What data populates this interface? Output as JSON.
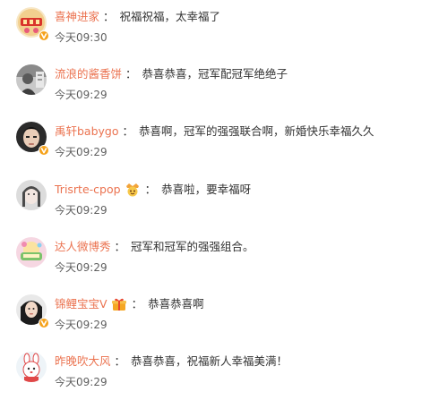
{
  "comments": [
    {
      "user": "喜神进家",
      "separator": "：",
      "text": "祝福祝福，太幸福了",
      "time": "今天09:30",
      "verified": true
    },
    {
      "user": "流浪的酱香饼",
      "separator": "：",
      "text": "恭喜恭喜，冠军配冠军绝绝子",
      "time": "今天09:29",
      "verified": false
    },
    {
      "user": "禹轩babygo",
      "separator": "：",
      "text": "恭喜啊，冠军的强强联合啊，新婚快乐幸福久久",
      "time": "今天09:29",
      "verified": true
    },
    {
      "user": "Trisrte-cpop",
      "separator": "：",
      "text": "恭喜啦，要幸福呀",
      "time": "今天09:29",
      "verified": false,
      "medal": "fan-medal-icon"
    },
    {
      "user": "达人微博秀",
      "separator": "：",
      "text": "冠军和冠军的强强组合。",
      "time": "今天09:29",
      "verified": false
    },
    {
      "user": "锦鲤宝宝V",
      "separator": "：",
      "text": "恭喜恭喜啊",
      "time": "今天09:29",
      "verified": true,
      "medal": "gift-medal-icon"
    },
    {
      "user": "昨晚吹大风",
      "separator": "：",
      "text": "恭喜恭喜，祝福新人幸福美满！",
      "time": "今天09:29",
      "verified": false
    }
  ],
  "colors": {
    "username": "#eb7350",
    "text": "#333333",
    "time": "#606060",
    "verified_badge": "#f5a21b"
  }
}
